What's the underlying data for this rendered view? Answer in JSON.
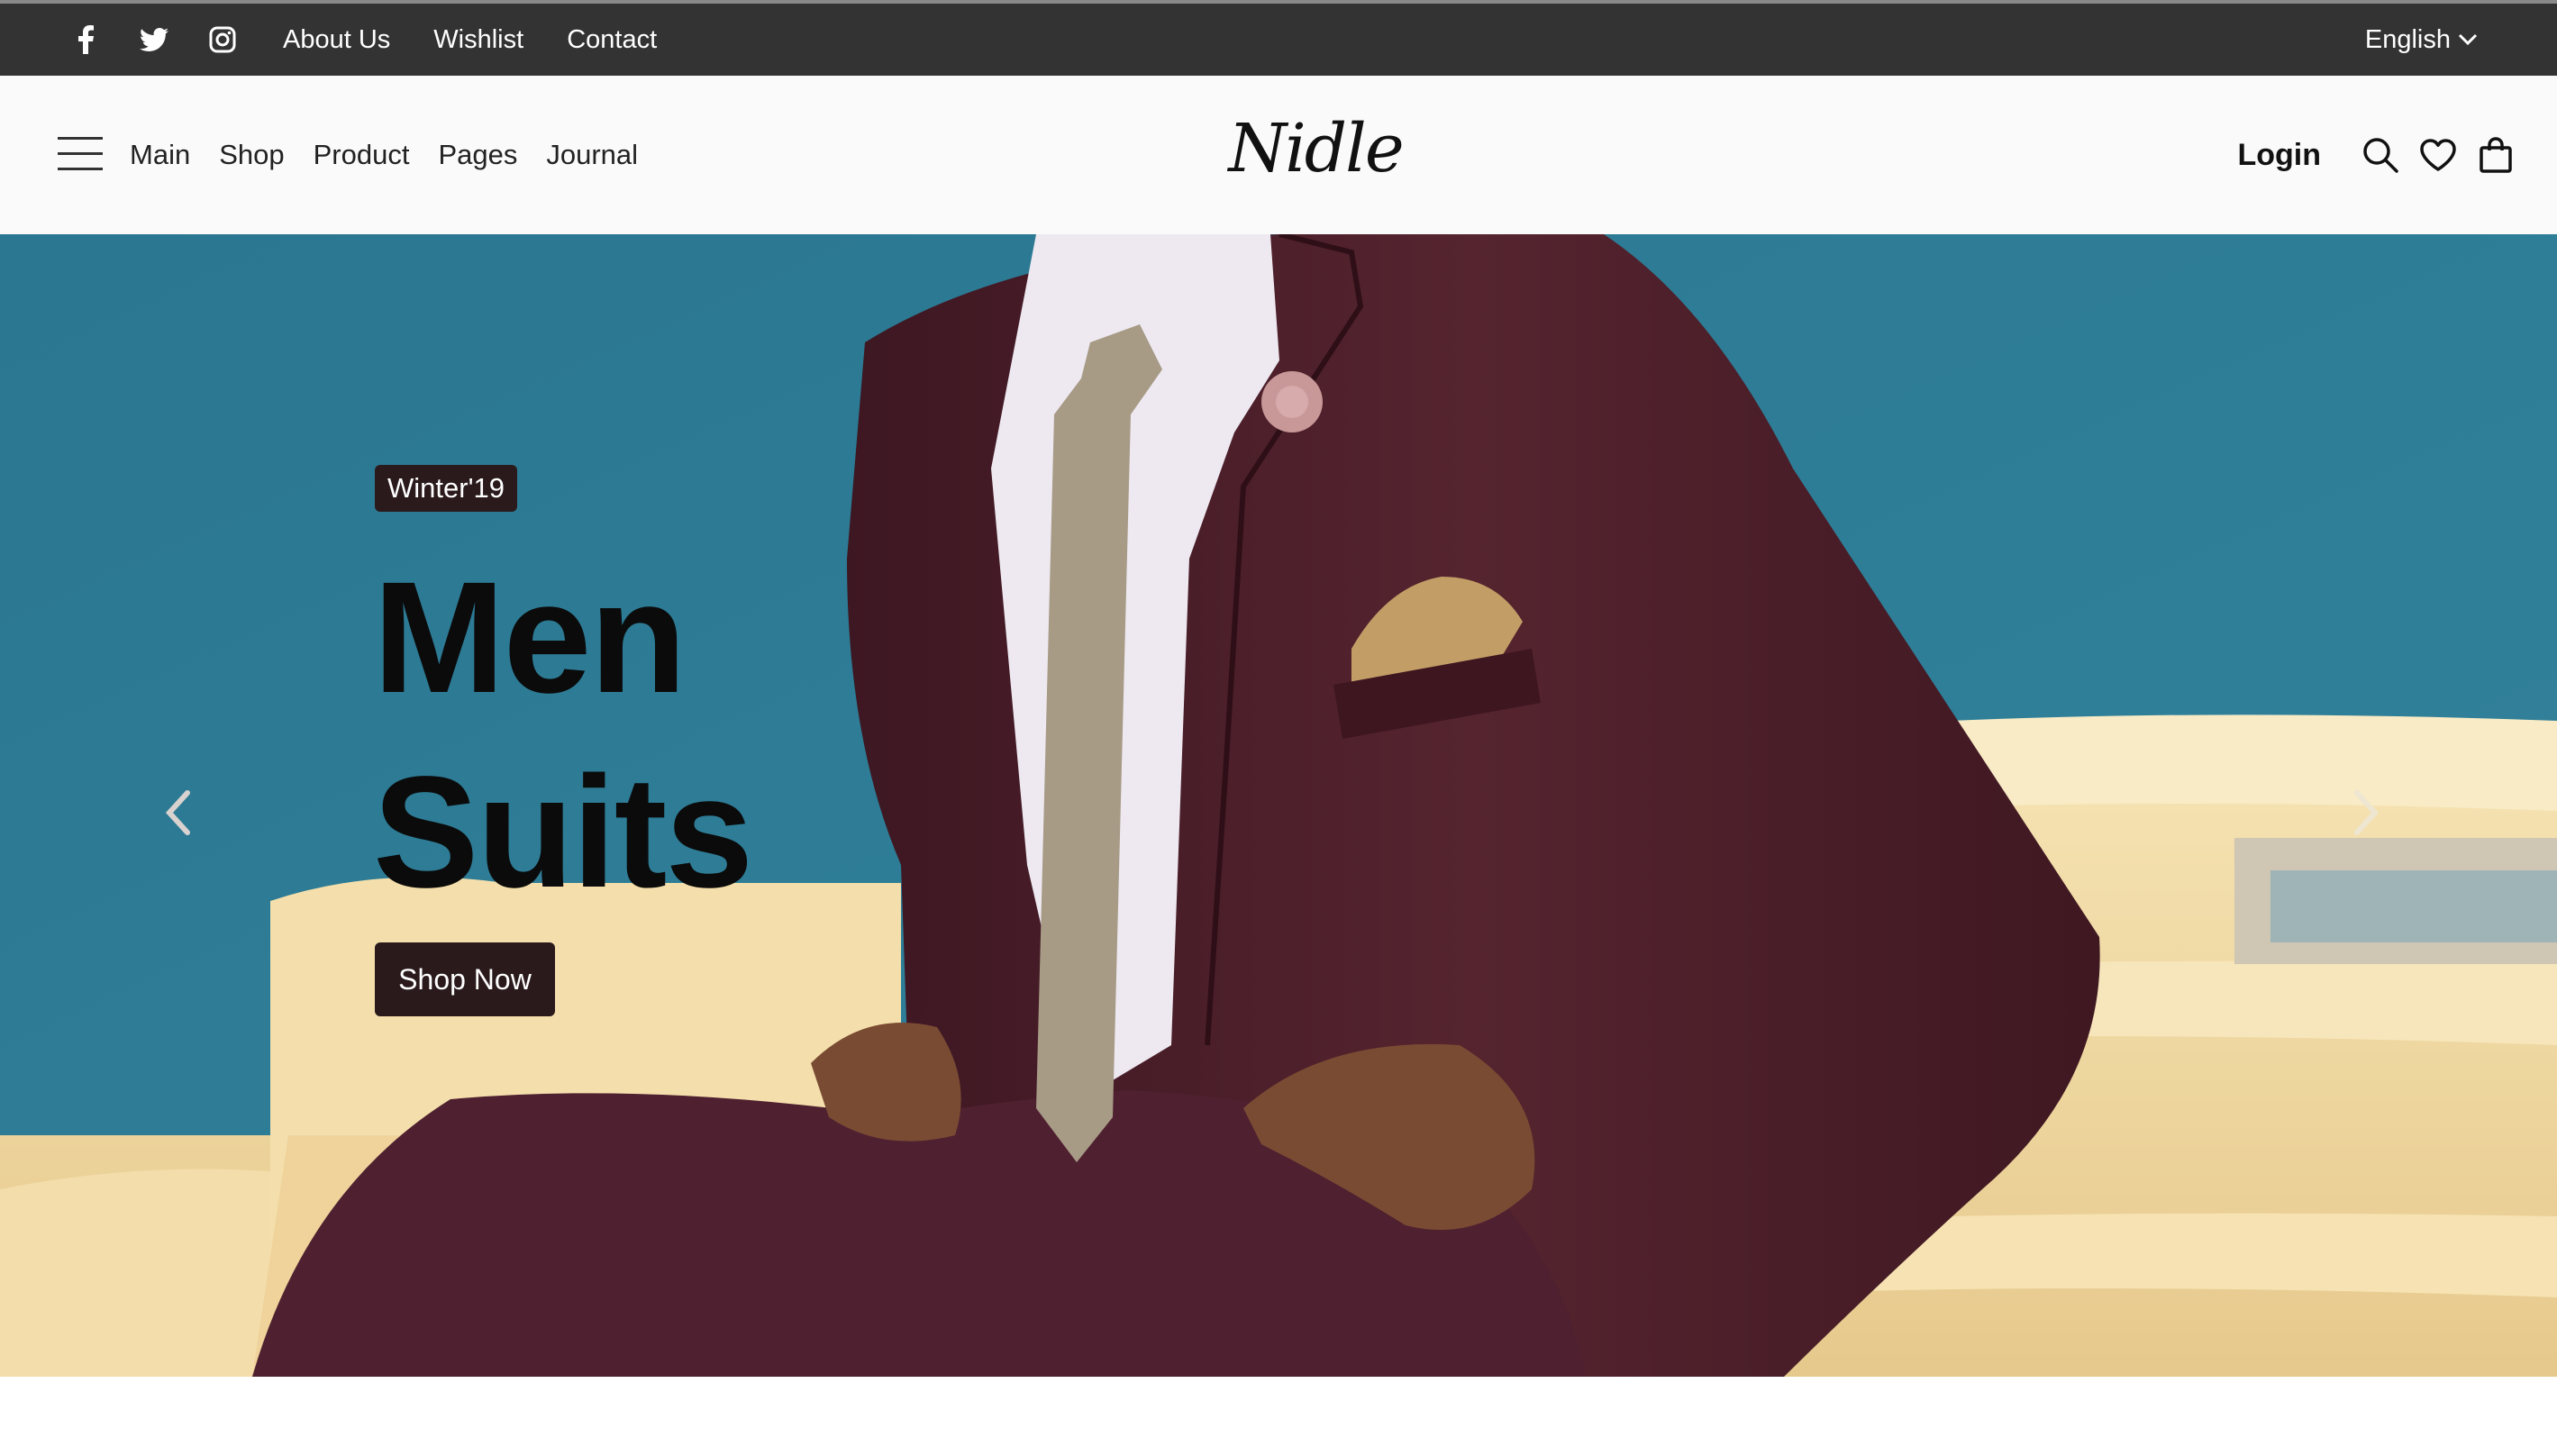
{
  "topbar": {
    "social": [
      "facebook-icon",
      "twitter-icon",
      "instagram-icon"
    ],
    "links": [
      "About Us",
      "Wishlist",
      "Contact"
    ],
    "language": "English"
  },
  "navbar": {
    "menu": [
      "Main",
      "Shop",
      "Product",
      "Pages",
      "Journal"
    ],
    "logo": "Nidle",
    "login": "Login",
    "icons": [
      "search-icon",
      "heart-icon",
      "bag-icon"
    ]
  },
  "hero": {
    "badge": "Winter'19",
    "headline_line1": "Men",
    "headline_line2": "Suits",
    "cta": "Shop Now",
    "colors": {
      "wall": "#2f7a94",
      "steps": "#f1d9a0",
      "suit": "#4a1e2a",
      "button": "#2a1a1c"
    }
  }
}
